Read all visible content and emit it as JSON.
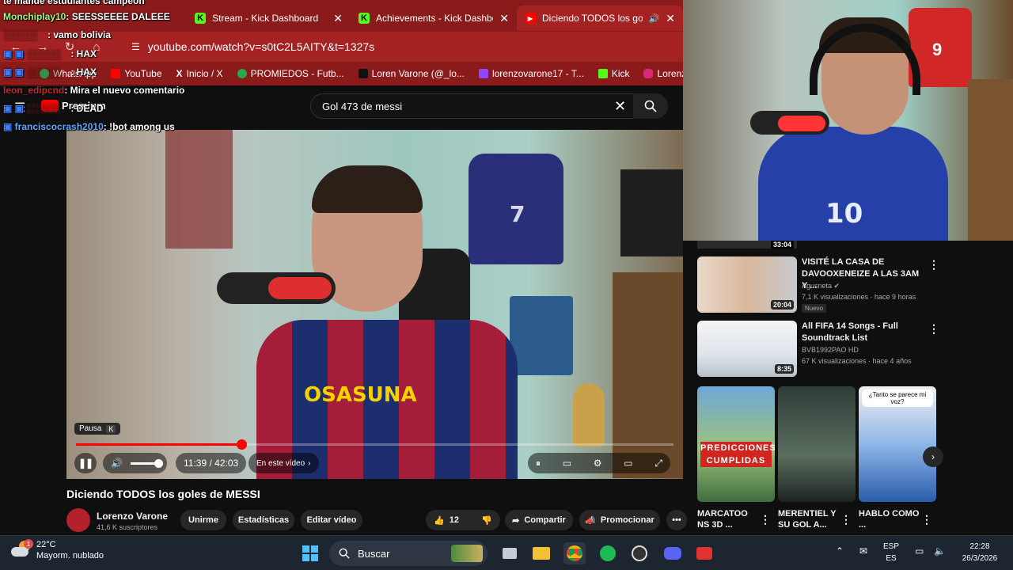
{
  "browser": {
    "tabs": [
      {
        "title": "Stream - Kick Dashboard",
        "icon": "kick-icon"
      },
      {
        "title": "Achievements - Kick Dashbo",
        "icon": "kick-icon"
      },
      {
        "title": "Diciendo TODOS los gol",
        "icon": "youtube-icon"
      }
    ],
    "url": "youtube.com/watch?v=s0tC2L5AITY&t=1327s",
    "bookmarks": [
      "WhatsApp",
      "YouTube",
      "Inicio / X",
      "PROMIEDOS - Futb...",
      "Loren Varone (@_lo...",
      "lorenzovarone17 - T...",
      "Kick",
      "Lorenzova"
    ]
  },
  "youtube": {
    "premium_label": "Premium",
    "search_value": "Gol 473 de messi"
  },
  "chat": [
    {
      "user": "",
      "message": "te mande estudiantes campeon"
    },
    {
      "user": "Monchiplay10",
      "message": ": SEESSEEEE DALEEE"
    },
    {
      "user": "",
      "message": ": vamo bolivia"
    },
    {
      "user": "",
      "message": ": HAX"
    },
    {
      "user": "",
      "message": ": HAX"
    },
    {
      "user": "leon_edipcnd",
      "message": ": Mira el nuevo comentario"
    },
    {
      "user": "",
      "message": ": DEAD"
    },
    {
      "user": "franciscocrash2010",
      "message": ": !bot among us"
    }
  ],
  "player": {
    "tooltip_label": "Pausa",
    "tooltip_key": "K",
    "time": "11:39 / 42:03",
    "progress": 0.277,
    "volume": 0.9,
    "chapters_label": "En este vídeo",
    "jersey_number": "7",
    "sponsor": "OSASUNA"
  },
  "video": {
    "title": "Diciendo TODOS los goles de MESSI",
    "channel": "Lorenzo Varone",
    "subscribers": "41,6 K suscriptores",
    "join_label": "Unirme",
    "stats_label": "Estadísticas",
    "edit_label": "Editar vídeo",
    "likes": "12",
    "share_label": "Compartir",
    "promote_label": "Promocionar"
  },
  "webcam": {
    "shirt_number": "10",
    "wall_jersey_number": "9"
  },
  "sidebar": {
    "top_duration": "33:04",
    "recommendations": [
      {
        "title": "VISITÉ LA CASA DE DAVOOXENEIZE A LAS 3AM Y ...",
        "channel": "Agusneta",
        "views": "7,1 K visualizaciones · hace 9 horas",
        "badge": "Nuevo",
        "duration": "20:04"
      },
      {
        "title": "All FIFA 14 Songs - Full Soundtrack List",
        "channel": "BVB1992PAO HD",
        "views": "67 K visualizaciones · hace 4 años",
        "badge": "",
        "duration": "8:35"
      }
    ],
    "shorts": [
      {
        "title": "MARCATOO NS 3D ...",
        "overlay": "PREDICCIONES CUMPLIDAS"
      },
      {
        "title": "MERENTIEL Y SU GOL A...",
        "overlay": ""
      },
      {
        "title": "HABLO COMO ...",
        "overlay": "¿Tanto se parece mi voz?"
      }
    ]
  },
  "taskbar": {
    "temperature": "22°C",
    "weather": "Mayorm. nublado",
    "weather_badge": "1",
    "search_placeholder": "Buscar",
    "language_top": "ESP",
    "language_bottom": "ES",
    "time": "22:28",
    "date": "26/3/2026"
  },
  "colors": {
    "browser_chrome": "#8b1a1a",
    "youtube_red": "#ff0000",
    "kick_green": "#53fc18"
  }
}
